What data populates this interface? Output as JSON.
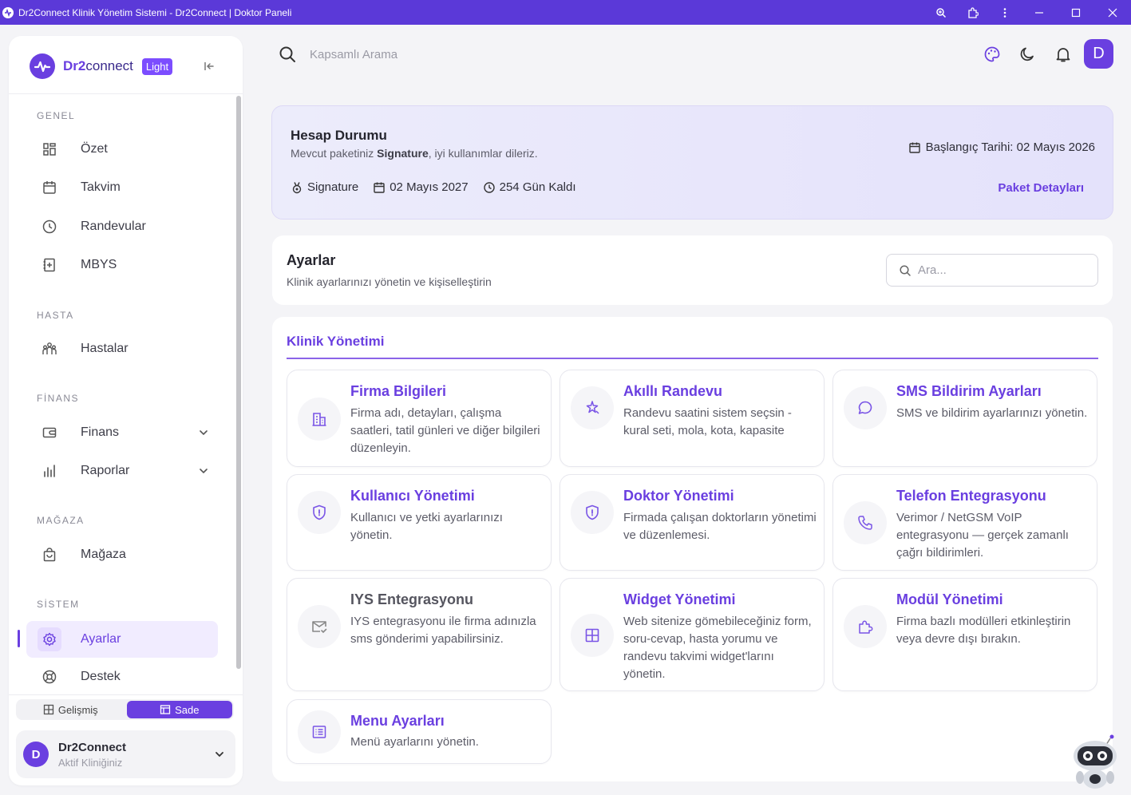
{
  "window": {
    "title": "Dr2Connect Klinik Yönetim Sistemi - Dr2Connect | Doktor Paneli"
  },
  "brand": {
    "name_prefix": "Dr2",
    "name_suffix": "connect",
    "badge": "Light"
  },
  "sidebar": {
    "sections": [
      {
        "title": "GENEL",
        "items": [
          {
            "label": "Özet",
            "icon": "dashboard-icon"
          },
          {
            "label": "Takvim",
            "icon": "calendar-icon"
          },
          {
            "label": "Randevular",
            "icon": "clock-icon"
          },
          {
            "label": "MBYS",
            "icon": "notebook-icon"
          }
        ]
      },
      {
        "title": "HASTA",
        "items": [
          {
            "label": "Hastalar",
            "icon": "patients-icon"
          }
        ]
      },
      {
        "title": "FİNANS",
        "items": [
          {
            "label": "Finans",
            "icon": "wallet-icon",
            "expandable": true
          },
          {
            "label": "Raporlar",
            "icon": "chart-bars-icon",
            "expandable": true
          }
        ]
      },
      {
        "title": "MAĞAZA",
        "items": [
          {
            "label": "Mağaza",
            "icon": "shopping-bag-icon"
          }
        ]
      },
      {
        "title": "SİSTEM",
        "items": [
          {
            "label": "Ayarlar",
            "icon": "gear-icon",
            "active": true
          },
          {
            "label": "Destek",
            "icon": "lifebuoy-icon"
          }
        ]
      }
    ],
    "mode_toggle": {
      "advanced": "Gelişmiş",
      "simple": "Sade",
      "selected": "Sade"
    },
    "clinic": {
      "avatar": "D",
      "name": "Dr2Connect",
      "subtitle": "Aktif Kliniğiniz"
    }
  },
  "topbar": {
    "search_placeholder": "Kapsamlı Arama",
    "user_initial": "D"
  },
  "account": {
    "title": "Hesap Durumu",
    "subtitle_pre": "Mevcut paketiniz ",
    "subtitle_package": "Signature",
    "subtitle_post": ", iyi kullanımlar dileriz.",
    "start_date": "Başlangıç Tarihi: 02 Mayıs 2026",
    "package": "Signature",
    "end_date": "02 Mayıs 2027",
    "remaining": "254 Gün Kaldı",
    "details_link": "Paket Detayları"
  },
  "settings": {
    "title": "Ayarlar",
    "subtitle": "Klinik ayarlarınızı yönetin ve kişiselleştirin",
    "search_placeholder": "Ara..."
  },
  "clinic_section": {
    "title": "Klinik Yönetimi",
    "cards": [
      {
        "title": "Firma Bilgileri",
        "desc": "Firma adı, detayları, çalışma saatleri, tatil günleri ve diğer bilgileri düzenleyin.",
        "icon": "building-icon"
      },
      {
        "title": "Akıllı Randevu",
        "desc": "Randevu saatini sistem seçsin - kural seti, mola, kota, kapasite",
        "icon": "sparkle-icon"
      },
      {
        "title": "SMS Bildirim Ayarları",
        "desc": "SMS ve bildirim ayarlarınızı yönetin.",
        "icon": "chat-bubble-icon"
      },
      {
        "title": "Kullanıcı Yönetimi",
        "desc": "Kullanıcı ve yetki ayarlarınızı yönetin.",
        "icon": "shield-icon"
      },
      {
        "title": "Doktor Yönetimi",
        "desc": "Firmada çalışan doktorların yönetimi ve düzenlemesi.",
        "icon": "shield-icon"
      },
      {
        "title": "Telefon Entegrasyonu",
        "desc": "Verimor / NetGSM VoIP entegrasyonu — gerçek zamanlı çağrı bildirimleri.",
        "icon": "phone-icon"
      },
      {
        "title": "IYS Entegrasyonu",
        "desc": "IYS entegrasyonu ile firma adınızla sms gönderimi yapabilirsiniz.",
        "icon": "mail-check-icon",
        "muted": true
      },
      {
        "title": "Widget Yönetimi",
        "desc": "Web sitenize gömebileceğiniz form, soru-cevap, hasta yorumu ve randevu takvimi widget'larını yönetin.",
        "icon": "layout-grid-icon"
      },
      {
        "title": "Modül Yönetimi",
        "desc": "Firma bazlı modülleri etkinleştirin veya devre dışı bırakın.",
        "icon": "puzzle-icon"
      },
      {
        "title": "Menu Ayarları",
        "desc": "Menü ayarlarını yönetin.",
        "icon": "list-icon"
      }
    ]
  },
  "colors": {
    "accent": "#6a3fe0",
    "titlebar": "#5b39d8",
    "badge": "#7c4dff"
  }
}
